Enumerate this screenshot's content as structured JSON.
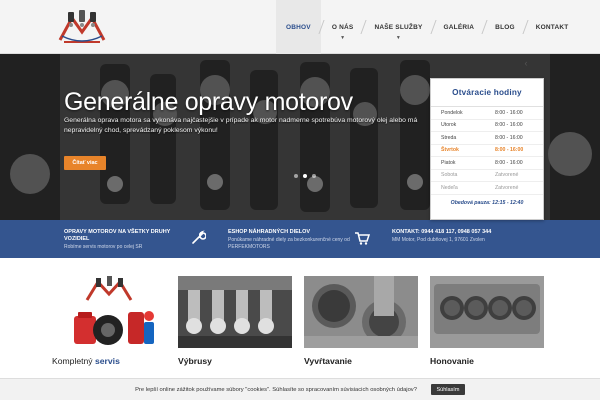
{
  "header": {
    "logo_icon": "engine-pistons-logo",
    "nav": [
      {
        "label": "Obhov",
        "active": true,
        "has_dropdown": false
      },
      {
        "label": "O nás",
        "active": false,
        "has_dropdown": true
      },
      {
        "label": "Naše služby",
        "active": false,
        "has_dropdown": true
      },
      {
        "label": "Galéria",
        "active": false,
        "has_dropdown": false
      },
      {
        "label": "Blog",
        "active": false,
        "has_dropdown": false
      },
      {
        "label": "Kontakt",
        "active": false,
        "has_dropdown": false
      }
    ],
    "accent_color": "#2a4d8c"
  },
  "hero": {
    "title": "Generálne opravy motorov",
    "text": "Generálna oprava motora sa vykonáva najčastejšie v prípade ak motor nadmerne spotrebúva motorový olej alebo má nepravidelný chod, sprevádzaný poklesom výkonu!",
    "button_label": "Čítať viac",
    "button_color": "#e8842a",
    "slides": 3,
    "active_slide": 1
  },
  "hours": {
    "title": "Otváracie hodiny",
    "rows": [
      {
        "day": "Pondelok",
        "time": "8:00 - 16:00",
        "state": "normal"
      },
      {
        "day": "Utorok",
        "time": "8:00 - 16:00",
        "state": "normal"
      },
      {
        "day": "Streda",
        "time": "8:00 - 16:00",
        "state": "normal"
      },
      {
        "day": "Štvrtok",
        "time": "8:00 - 16:00",
        "state": "today"
      },
      {
        "day": "Piatok",
        "time": "8:00 - 16:00",
        "state": "normal"
      },
      {
        "day": "Sobota",
        "time": "Zatvorené",
        "state": "off"
      },
      {
        "day": "Nedeľa",
        "time": "Zatvorené",
        "state": "off"
      }
    ],
    "note": "Obedová pauza: 12:15 - 12:40"
  },
  "infobar": {
    "color": "#34558f",
    "columns": [
      {
        "title": "Opravy motorov na všetky druhy vozidiel",
        "text": "Robíme servis motorov po celej SR",
        "icon": "wrench-icon"
      },
      {
        "title": "Eshop náhradných dielov",
        "text": "Ponúkame náhradné diely za bezkonkurenčné ceny od PERFEKMOTORS",
        "icon": "cart-icon"
      },
      {
        "title": "Kontakt: 0944 418 117, 0948 057 344",
        "text": "MM Motor, Pod dubňovej 1, 97601 Zvolen",
        "icon": "phone-icon"
      }
    ]
  },
  "services": [
    {
      "label_plain": "Kompletný",
      "label_bold": "servis",
      "image": "service-logo-image"
    },
    {
      "label_plain": "",
      "label_bold": "Výbrusy",
      "image": "crankshaft-image"
    },
    {
      "label_plain": "",
      "label_bold": "Vyvŕtavanie",
      "image": "cylinder-boring-image"
    },
    {
      "label_plain": "",
      "label_bold": "Honovanie",
      "image": "engine-block-image"
    }
  ],
  "cookie": {
    "text": "Pre lepší online zážitok používame súbory \"cookies\". Súhlasíte so spracovaním súvisiacich osobných údajov?",
    "button_label": "Súhlasím"
  }
}
